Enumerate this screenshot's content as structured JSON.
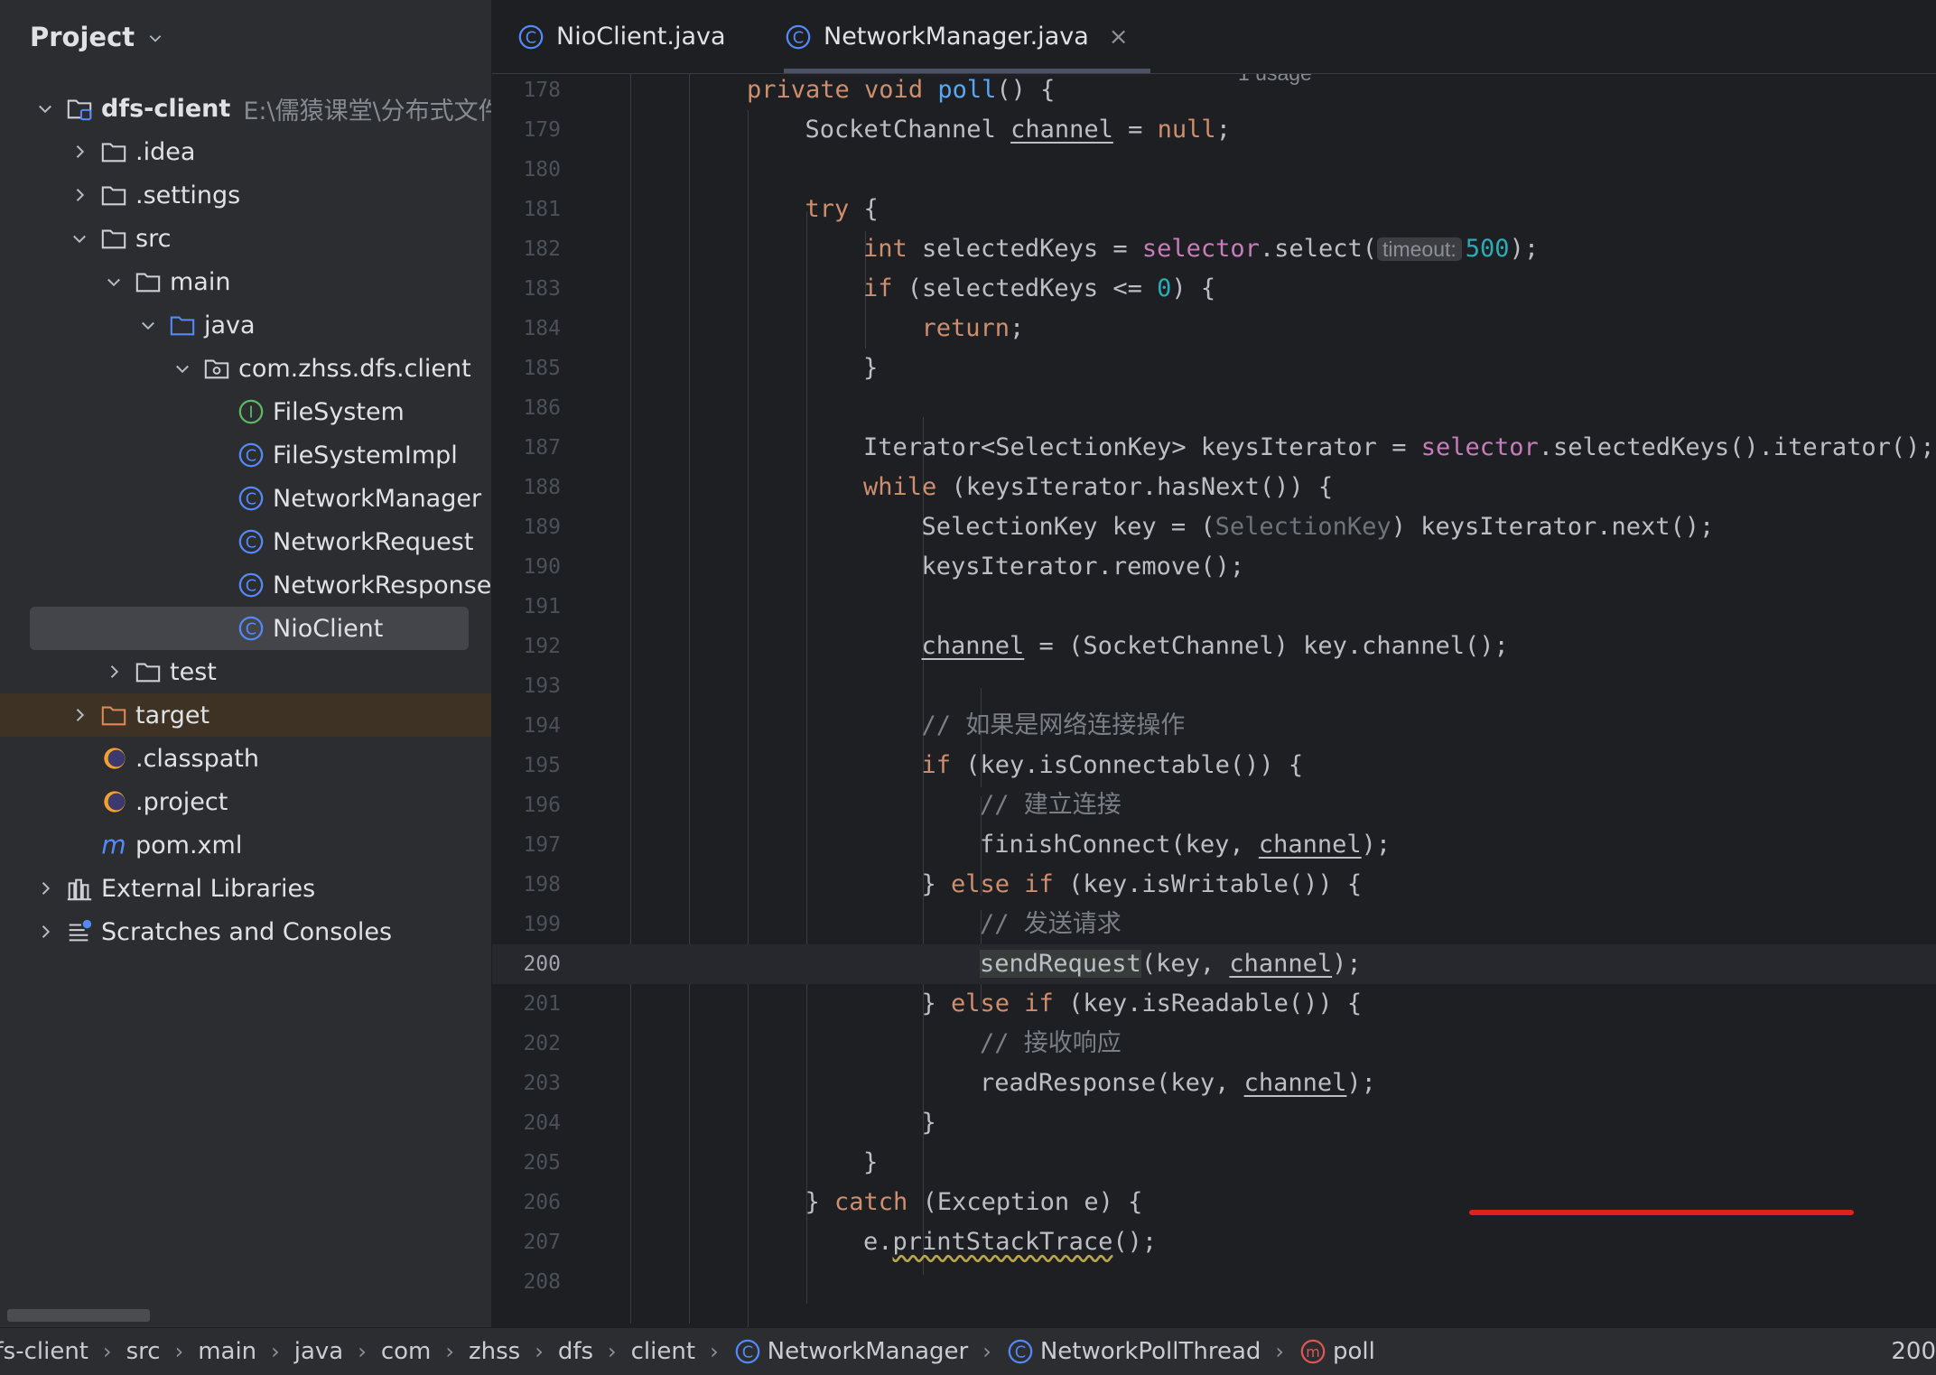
{
  "project": {
    "title": "Project",
    "tree": [
      {
        "label": "dfs-client",
        "path": "E:\\儒猿课堂\\分布式文件系",
        "chev": "down",
        "icon": "module-folder-icon",
        "bold": true
      },
      {
        "label": ".idea",
        "chev": "right",
        "icon": "folder-icon"
      },
      {
        "label": ".settings",
        "chev": "right",
        "icon": "folder-icon"
      },
      {
        "label": "src",
        "chev": "down",
        "icon": "folder-icon"
      },
      {
        "label": "main",
        "chev": "down",
        "icon": "folder-icon"
      },
      {
        "label": "java",
        "chev": "down",
        "icon": "source-folder-icon"
      },
      {
        "label": "com.zhss.dfs.client",
        "chev": "down",
        "icon": "package-icon"
      },
      {
        "label": "FileSystem",
        "icon": "interface-icon"
      },
      {
        "label": "FileSystemImpl",
        "icon": "class-icon"
      },
      {
        "label": "NetworkManager",
        "icon": "class-icon"
      },
      {
        "label": "NetworkRequest",
        "icon": "class-icon"
      },
      {
        "label": "NetworkResponse",
        "icon": "class-icon"
      },
      {
        "label": "NioClient",
        "icon": "class-icon",
        "selected": true
      },
      {
        "label": "test",
        "chev": "right",
        "icon": "folder-icon"
      },
      {
        "label": "target",
        "chev": "right",
        "icon": "excluded-folder-icon",
        "excluded": true
      },
      {
        "label": ".classpath",
        "icon": "eclipse-icon"
      },
      {
        "label": ".project",
        "icon": "eclipse-icon"
      },
      {
        "label": "pom.xml",
        "icon": "maven-icon"
      },
      {
        "label": "External Libraries",
        "chev": "right",
        "icon": "library-icon"
      },
      {
        "label": "Scratches and Consoles",
        "chev": "right",
        "icon": "scratches-icon"
      }
    ]
  },
  "tabs": [
    {
      "label": "NioClient.java",
      "icon": "class-icon",
      "active": false
    },
    {
      "label": "NetworkManager.java",
      "icon": "class-icon",
      "active": true,
      "close": "×"
    }
  ],
  "editor": {
    "usage_hint": "1 usage",
    "current_line": 200,
    "lines": [
      {
        "n": "178",
        "parts": [
          [
            "kw",
            "private "
          ],
          [
            "kw",
            "void "
          ],
          [
            "fn",
            "poll"
          ],
          [
            "",
            "() {"
          ]
        ]
      },
      {
        "n": "179",
        "parts": [
          [
            "",
            "SocketChannel "
          ],
          [
            "u",
            "channel"
          ],
          [
            "",
            " = "
          ],
          [
            "kw",
            "null"
          ],
          [
            "",
            ";"
          ]
        ]
      },
      {
        "n": "180",
        "parts": []
      },
      {
        "n": "181",
        "parts": [
          [
            "kw",
            "try "
          ],
          [
            "",
            "{"
          ]
        ]
      },
      {
        "n": "182",
        "parts": [
          [
            "kw",
            "int "
          ],
          [
            "",
            "selectedKeys = "
          ],
          [
            "fld",
            "selector"
          ],
          [
            "",
            ".select("
          ],
          [
            "hint",
            "timeout:"
          ],
          [
            "num",
            "500"
          ],
          [
            "",
            ");"
          ]
        ]
      },
      {
        "n": "183",
        "parts": [
          [
            "kw",
            "if "
          ],
          [
            "",
            "(selectedKeys <= "
          ],
          [
            "num",
            "0"
          ],
          [
            "",
            ") {"
          ]
        ]
      },
      {
        "n": "184",
        "parts": [
          [
            "kw",
            "return"
          ],
          [
            "",
            ";"
          ]
        ]
      },
      {
        "n": "185",
        "parts": [
          [
            "",
            "}"
          ]
        ]
      },
      {
        "n": "186",
        "parts": []
      },
      {
        "n": "187",
        "parts": [
          [
            "",
            "Iterator<SelectionKey> keysIterator = "
          ],
          [
            "fld",
            "selector"
          ],
          [
            "",
            ".selectedKeys().iterator();"
          ]
        ]
      },
      {
        "n": "188",
        "parts": [
          [
            "kw",
            "while "
          ],
          [
            "",
            "(keysIterator.hasNext()) {"
          ]
        ]
      },
      {
        "n": "189",
        "parts": [
          [
            "",
            "SelectionKey key = ("
          ],
          [
            "cast",
            "SelectionKey"
          ],
          [
            "",
            ") keysIterator.next();"
          ]
        ]
      },
      {
        "n": "190",
        "parts": [
          [
            "",
            "keysIterator.remove();"
          ]
        ]
      },
      {
        "n": "191",
        "parts": []
      },
      {
        "n": "192",
        "parts": [
          [
            "u",
            "channel"
          ],
          [
            "",
            " = (SocketChannel) key.channel();"
          ]
        ]
      },
      {
        "n": "193",
        "parts": []
      },
      {
        "n": "194",
        "parts": [
          [
            "cmt",
            "// 如果是网络连接操作"
          ]
        ]
      },
      {
        "n": "195",
        "parts": [
          [
            "kw",
            "if "
          ],
          [
            "",
            "(key.isConnectable()) {"
          ]
        ]
      },
      {
        "n": "196",
        "parts": [
          [
            "cmt",
            "// 建立连接"
          ]
        ]
      },
      {
        "n": "197",
        "parts": [
          [
            "",
            "finishConnect(key, "
          ],
          [
            "u",
            "channel"
          ],
          [
            "",
            ");"
          ]
        ]
      },
      {
        "n": "198",
        "parts": [
          [
            "",
            "} "
          ],
          [
            "kw",
            "else if "
          ],
          [
            "",
            "(key.isWritable()) {"
          ]
        ]
      },
      {
        "n": "199",
        "parts": [
          [
            "cmt",
            "// 发送请求"
          ]
        ]
      },
      {
        "n": "200",
        "parts": [
          [
            "hl",
            "sendRequest"
          ],
          [
            "",
            "(key, "
          ],
          [
            "u",
            "channel"
          ],
          [
            "",
            ");"
          ]
        ]
      },
      {
        "n": "201",
        "parts": [
          [
            "",
            "} "
          ],
          [
            "kw",
            "else if "
          ],
          [
            "",
            "(key.isReadable()) {"
          ]
        ]
      },
      {
        "n": "202",
        "parts": [
          [
            "cmt",
            "// 接收响应"
          ]
        ]
      },
      {
        "n": "203",
        "parts": [
          [
            "",
            "readResponse(key, "
          ],
          [
            "u",
            "channel"
          ],
          [
            "",
            ");"
          ]
        ]
      },
      {
        "n": "204",
        "parts": [
          [
            "",
            "}"
          ]
        ]
      },
      {
        "n": "205",
        "parts": [
          [
            "",
            "}"
          ]
        ]
      },
      {
        "n": "206",
        "parts": [
          [
            "",
            "} "
          ],
          [
            "kw",
            "catch "
          ],
          [
            "",
            "(Exception e) {"
          ]
        ]
      },
      {
        "n": "207",
        "parts": [
          [
            "",
            "e."
          ],
          [
            "squig",
            "printStackTrace"
          ],
          [
            "",
            "();"
          ]
        ]
      },
      {
        "n": "208",
        "parts": []
      }
    ]
  },
  "breadcrumb": {
    "items": [
      {
        "label": "dfs-client"
      },
      {
        "label": "src"
      },
      {
        "label": "main"
      },
      {
        "label": "java"
      },
      {
        "label": "com"
      },
      {
        "label": "zhss"
      },
      {
        "label": "dfs"
      },
      {
        "label": "client"
      },
      {
        "label": "NetworkManager",
        "icon": "class-icon"
      },
      {
        "label": "NetworkPollThread",
        "icon": "class-icon"
      },
      {
        "label": "poll",
        "icon": "method-icon"
      }
    ],
    "separator": "›",
    "line_col": "200"
  },
  "colors": {
    "background": "#1e1f22",
    "panel": "#2b2d30",
    "keyword": "#cf8e6d",
    "function": "#56a8f5",
    "field": "#c77dbb",
    "number": "#2aacb8",
    "comment": "#7a7e85",
    "annotation_underline": "#e0201c"
  }
}
